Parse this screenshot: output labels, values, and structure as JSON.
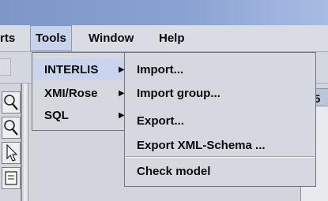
{
  "menubar": {
    "items": [
      {
        "label": "rts"
      },
      {
        "label": "Tools"
      },
      {
        "label": "Window"
      },
      {
        "label": "Help"
      }
    ]
  },
  "tools_menu": {
    "items": [
      {
        "label": "INTERLIS",
        "submenu_icon": "triangle-right-icon"
      },
      {
        "label": "XMI/Rose",
        "submenu_icon": "triangle-right-icon"
      },
      {
        "label": "SQL",
        "submenu_icon": "triangle-right-icon"
      }
    ]
  },
  "interlis_submenu": {
    "items": [
      {
        "label": "Import..."
      },
      {
        "label": "Import group..."
      },
      {
        "label": "Export..."
      },
      {
        "label": "Export XML-Schema ..."
      },
      {
        "label": "Check model"
      }
    ]
  },
  "background": {
    "right_tab_text": "n5"
  },
  "palette_icons": [
    "zoom-icon",
    "zoom-icon",
    "select-arrow-icon",
    "note-icon"
  ],
  "colors": {
    "selection": "#c8d5ec",
    "menu_bg": "#d5d9df",
    "title_gradient_left": "#7f96c8",
    "title_gradient_right": "#a9bce3"
  }
}
